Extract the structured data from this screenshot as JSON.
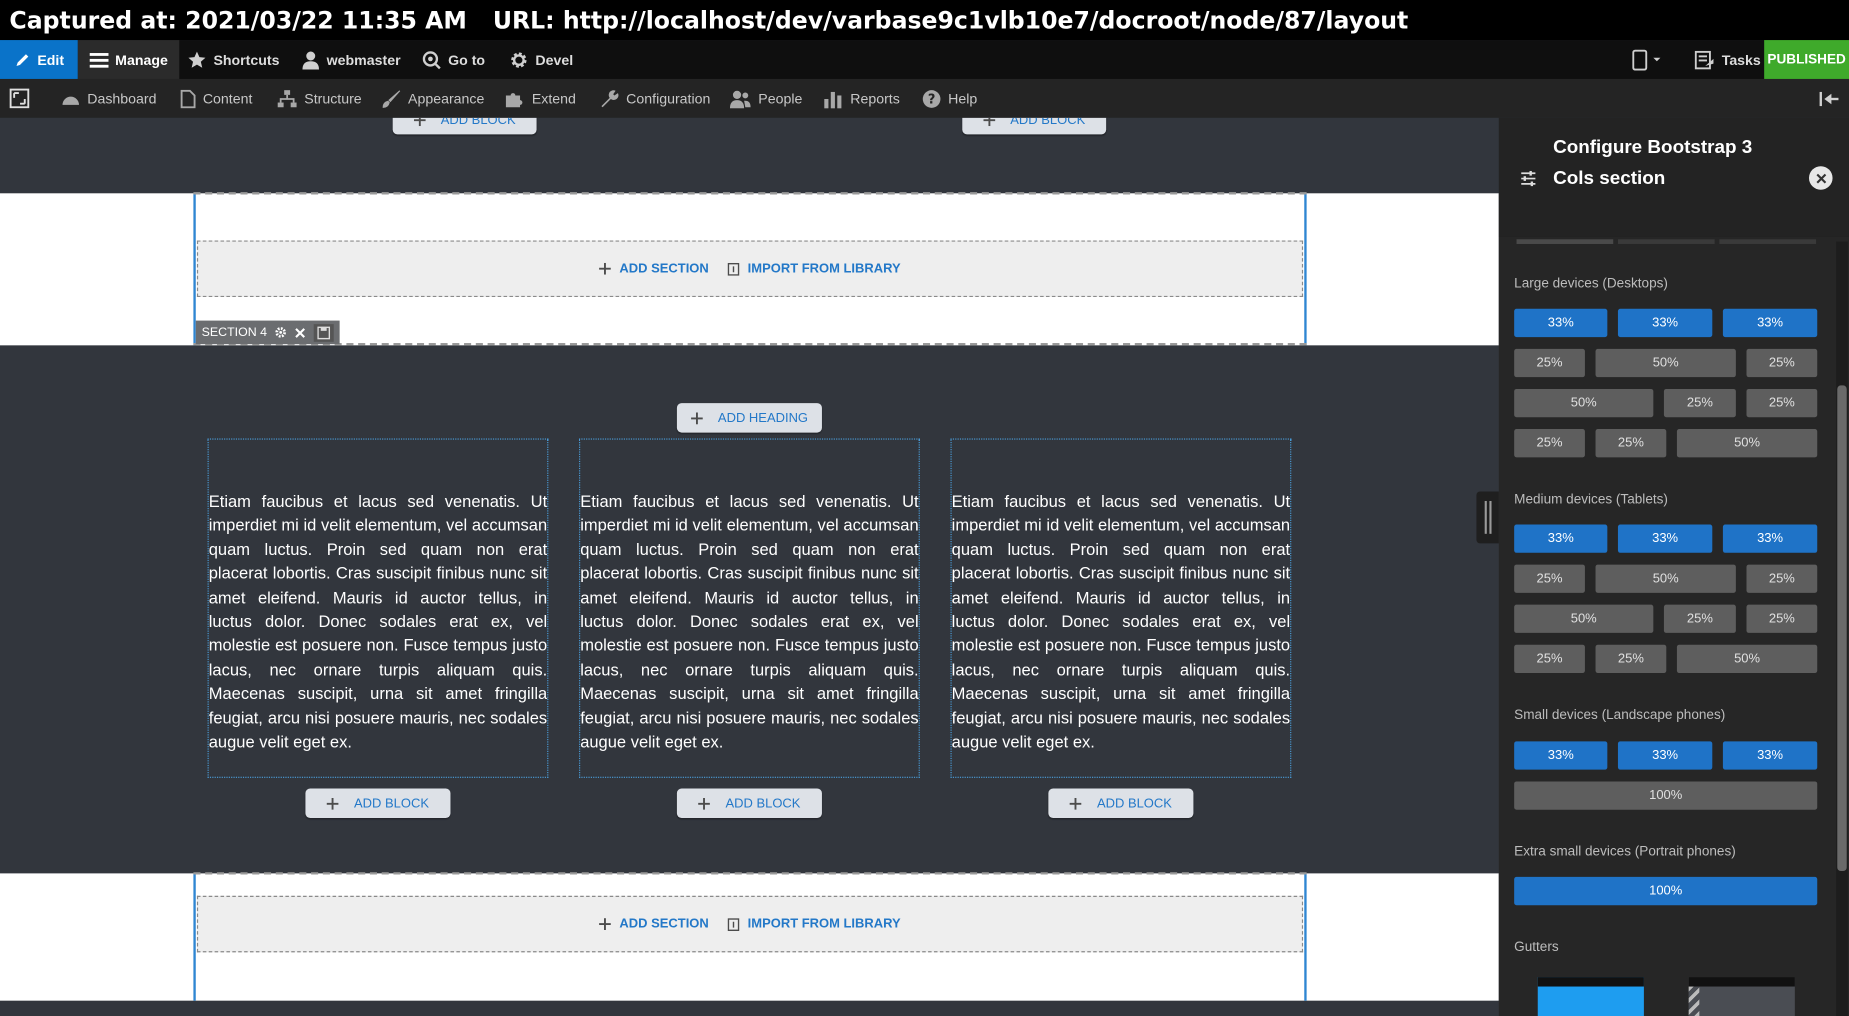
{
  "capture": {
    "captured_at": "Captured at: 2021/03/22 11:35 AM",
    "url": "URL: http://localhost/dev/varbase9c1vlb10e7/docroot/node/87/layout"
  },
  "toolbar": {
    "edit": "Edit",
    "manage": "Manage",
    "shortcuts": "Shortcuts",
    "user": "webmaster",
    "goto": "Go to",
    "devel": "Devel",
    "tasks": "Tasks",
    "status": "PUBLISHED",
    "colors": {
      "edit": "#0a73c9",
      "published": "#3faa2b"
    }
  },
  "admin_menu": {
    "items": [
      {
        "label": "Dashboard",
        "icon": "dashboard-icon"
      },
      {
        "label": "Content",
        "icon": "file-icon"
      },
      {
        "label": "Structure",
        "icon": "sitemap-icon"
      },
      {
        "label": "Appearance",
        "icon": "paintbrush-icon"
      },
      {
        "label": "Extend",
        "icon": "puzzle-icon"
      },
      {
        "label": "Configuration",
        "icon": "wrench-icon"
      },
      {
        "label": "People",
        "icon": "people-icon"
      },
      {
        "label": "Reports",
        "icon": "bar-chart-icon"
      },
      {
        "label": "Help",
        "icon": "help-icon"
      }
    ]
  },
  "layout": {
    "add_block": "ADD BLOCK",
    "add_section": "ADD SECTION",
    "import_library": "IMPORT FROM LIBRARY",
    "section_label": "SECTION 4",
    "add_heading": "ADD HEADING",
    "body_text": "Etiam faucibus et lacus sed venenatis. Ut imperdiet mi id velit elementum, vel accumsan quam luctus. Proin sed quam non erat placerat lobortis. Cras suscipit finibus nunc sit amet eleifend. Mauris id auctor tellus, in luctus dolor. Donec sodales erat ex, vel molestie est posuere non. Fusce tempus justo lacus, nec ornare turpis aliquam quis. Maecenas suscipit, urna sit amet fringilla feugiat, arcu nisi posuere mauris, nec sodales augue velit eget ex."
  },
  "panel": {
    "title": "Configure Bootstrap 3 Cols section",
    "groups": {
      "large": "Large devices (Desktops)",
      "medium": "Medium devices (Tablets)",
      "small": "Small devices (Landscape phones)",
      "xsmall": "Extra small devices (Portrait phones)",
      "gutters": "Gutters"
    },
    "options": {
      "p33": "33%",
      "p25": "25%",
      "p50": "50%",
      "p100": "100%"
    },
    "colors": {
      "selected": "#1f73c7",
      "unselected": "#5e5e5e"
    }
  }
}
